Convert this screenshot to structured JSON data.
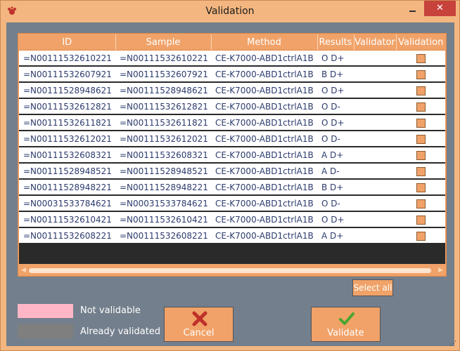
{
  "window": {
    "title": "Validation",
    "close_label": "✕"
  },
  "columns": [
    "ID",
    "Sample",
    "Method",
    "Results",
    "Validator",
    "Validation"
  ],
  "rows": [
    {
      "id": "=N00111532610221",
      "sample": "=N00111532610221",
      "method": "CE-K7000-ABD1ctrlA1B",
      "results": "O D+",
      "validator": "",
      "validated": false
    },
    {
      "id": "=N00111532607921",
      "sample": "=N00111532607921",
      "method": "CE-K7000-ABD1ctrlA1B",
      "results": "B D+",
      "validator": "",
      "validated": false
    },
    {
      "id": "=N00111528948621",
      "sample": "=N00111528948621",
      "method": "CE-K7000-ABD1ctrlA1B",
      "results": "O D+",
      "validator": "",
      "validated": false
    },
    {
      "id": "=N00111532612821",
      "sample": "=N00111532612821",
      "method": "CE-K7000-ABD1ctrlA1B",
      "results": "O D-",
      "validator": "",
      "validated": false
    },
    {
      "id": "=N00111532611821",
      "sample": "=N00111532611821",
      "method": "CE-K7000-ABD1ctrlA1B",
      "results": "O D+",
      "validator": "",
      "validated": false
    },
    {
      "id": "=N00111532612021",
      "sample": "=N00111532612021",
      "method": "CE-K7000-ABD1ctrlA1B",
      "results": "O D-",
      "validator": "",
      "validated": false
    },
    {
      "id": "=N00111532608321",
      "sample": "=N00111532608321",
      "method": "CE-K7000-ABD1ctrlA1B",
      "results": "A D+",
      "validator": "",
      "validated": false
    },
    {
      "id": "=N00111528948521",
      "sample": "=N00111528948521",
      "method": "CE-K7000-ABD1ctrlA1B",
      "results": "A D-",
      "validator": "",
      "validated": false
    },
    {
      "id": "=N00111528948221",
      "sample": "=N00111528948221",
      "method": "CE-K7000-ABD1ctrlA1B",
      "results": "B D+",
      "validator": "",
      "validated": false
    },
    {
      "id": "=N00031533784621",
      "sample": "=N00031533784621",
      "method": "CE-K7000-ABD1ctrlA1B",
      "results": "O D-",
      "validator": "",
      "validated": false
    },
    {
      "id": "=N00111532610421",
      "sample": "=N00111532610421",
      "method": "CE-K7000-ABD1ctrlA1B",
      "results": "O D+",
      "validator": "",
      "validated": false
    },
    {
      "id": "=N00111532608221",
      "sample": "=N00111532608221",
      "method": "CE-K7000-ABD1ctrlA1B",
      "results": "A D+",
      "validator": "",
      "validated": false
    }
  ],
  "select_all_label": "Select all",
  "legend": [
    {
      "label": "Not validable",
      "color": "#ffb6c6"
    },
    {
      "label": "Already validated",
      "color": "#7f7f7f"
    }
  ],
  "buttons": {
    "cancel": "Cancel",
    "validate": "Validate"
  },
  "colors": {
    "accent": "#f0a268",
    "background": "#737f8c",
    "cancel_icon": "#c0302a",
    "validate_icon": "#4aa52e"
  }
}
